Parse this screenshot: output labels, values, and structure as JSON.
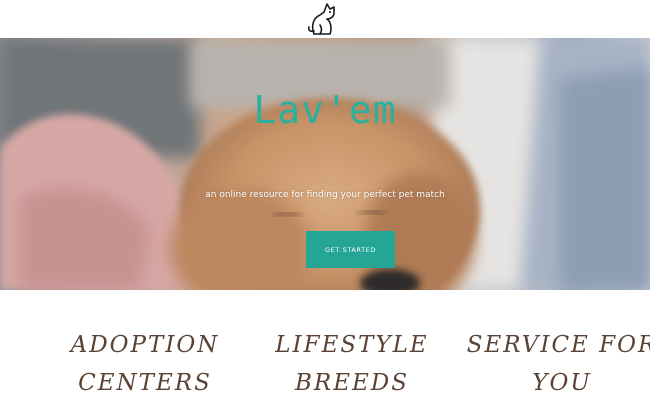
{
  "header": {
    "logo_icon": "dog-sitting-icon"
  },
  "hero": {
    "title": "Lav'em",
    "tagline": "an online resource for finding your perfect pet match",
    "cta_label": "GET STARTED",
    "title_color": "#2bb0a0",
    "cta_color": "#24a596",
    "background": "puppy-photo"
  },
  "features": [
    {
      "label": "ADOPTION CENTERS"
    },
    {
      "label": "LIFESTYLE BREEDS"
    },
    {
      "label": "SERVICE FOR YOU"
    }
  ],
  "colors": {
    "feature_text": "#5a4235"
  }
}
